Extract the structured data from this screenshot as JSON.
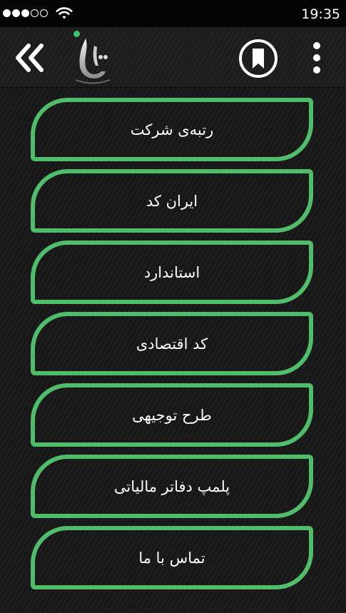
{
  "status_bar": {
    "time": "19:35",
    "signal_bars_filled": 3,
    "signal_bars_total": 5,
    "wifi_icon": "wifi-icon"
  },
  "app_bar": {
    "back_icon": "double-chevron-left-icon",
    "logo_icon": "app-logo",
    "bookmark_icon": "bookmark-icon",
    "overflow_icon": "vertical-dots-icon"
  },
  "menu": {
    "items": [
      {
        "label": "رتبه‌ی شرکت"
      },
      {
        "label": "ایران کد"
      },
      {
        "label": "استاندارد"
      },
      {
        "label": "کد اقتصادی"
      },
      {
        "label": "طرح توجیهی"
      },
      {
        "label": "پلمپ دفاتر مالیاتی"
      },
      {
        "label": "تماس با ما"
      }
    ]
  },
  "colors": {
    "accent": "#4fbd6a",
    "background": "#171717",
    "status_bar": "#050505",
    "text": "#ffffff"
  }
}
